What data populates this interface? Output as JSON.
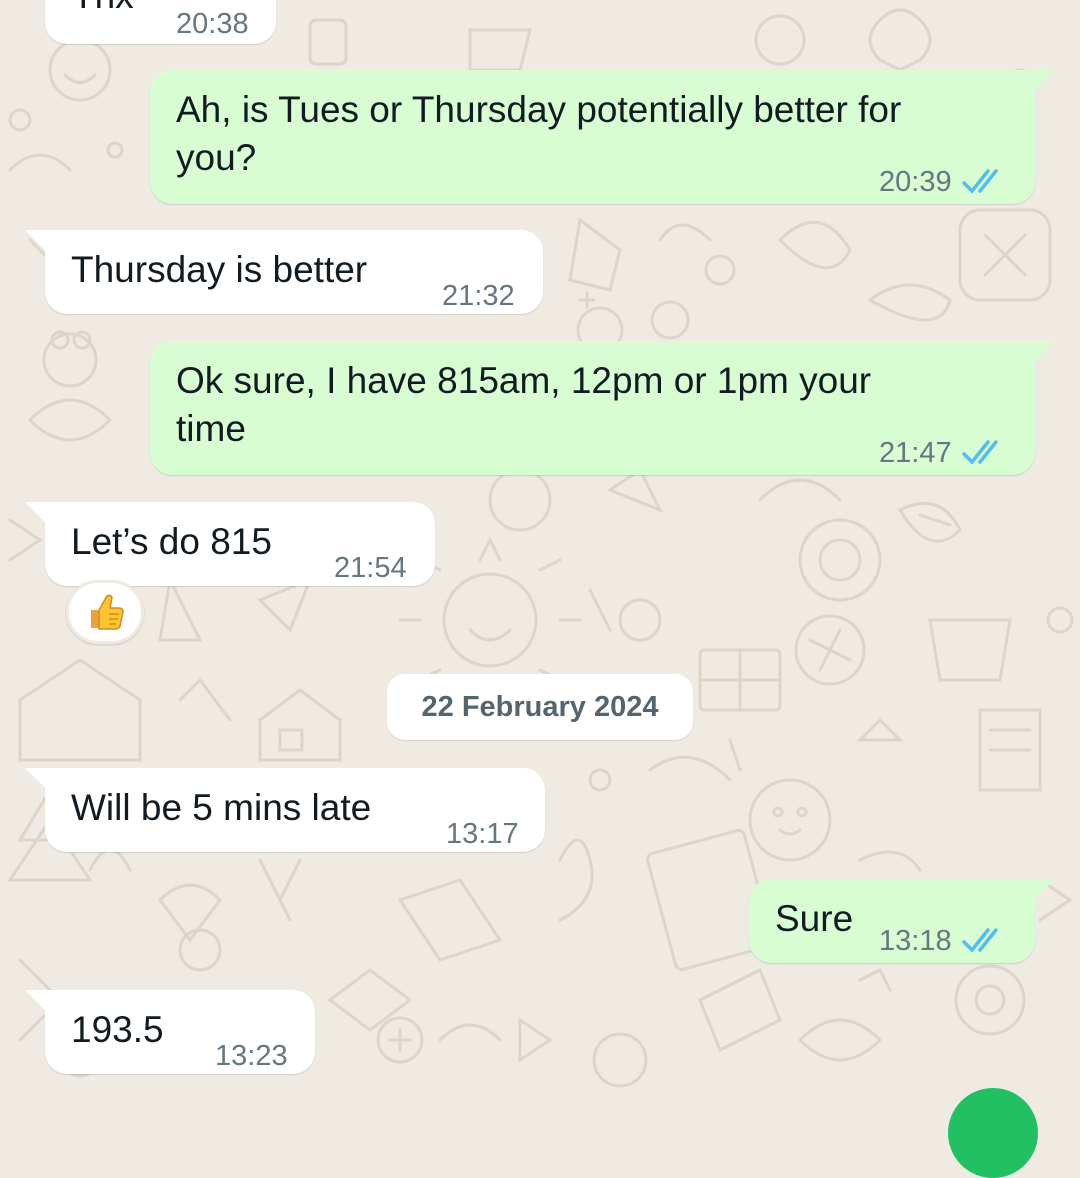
{
  "colors": {
    "background": "#efeae2",
    "incoming_bubble": "#ffffff",
    "outgoing_bubble": "#d9fdd3",
    "read_ticks": "#53bdeb",
    "timestamp": "#667781",
    "fab": "#21c063"
  },
  "messages": [
    {
      "direction": "incoming",
      "text": "Thx",
      "time": "20:38"
    },
    {
      "direction": "outgoing",
      "line1": "Ah, is Tues or Thursday potentially better for",
      "line2": "you?",
      "time": "20:39",
      "status": "read",
      "status_icon": "double-check-icon"
    },
    {
      "direction": "incoming",
      "text": "Thursday is better",
      "time": "21:32"
    },
    {
      "direction": "outgoing",
      "line1": "Ok sure, I have 815am, 12pm or 1pm your",
      "line2": "time",
      "time": "21:47",
      "status": "read",
      "status_icon": "double-check-icon"
    },
    {
      "direction": "incoming",
      "text": "Let’s do 815",
      "time": "21:54",
      "reaction": "thumbs-up-emoji"
    },
    {
      "direction": "incoming",
      "text": "Will be 5 mins late",
      "time": "13:17"
    },
    {
      "direction": "outgoing",
      "text": "Sure",
      "time": "13:18",
      "status": "read",
      "status_icon": "double-check-icon"
    },
    {
      "direction": "incoming",
      "text": "193.5",
      "time": "13:23"
    }
  ],
  "date_separator": "22 February 2024",
  "fab_icon": "action-fab"
}
